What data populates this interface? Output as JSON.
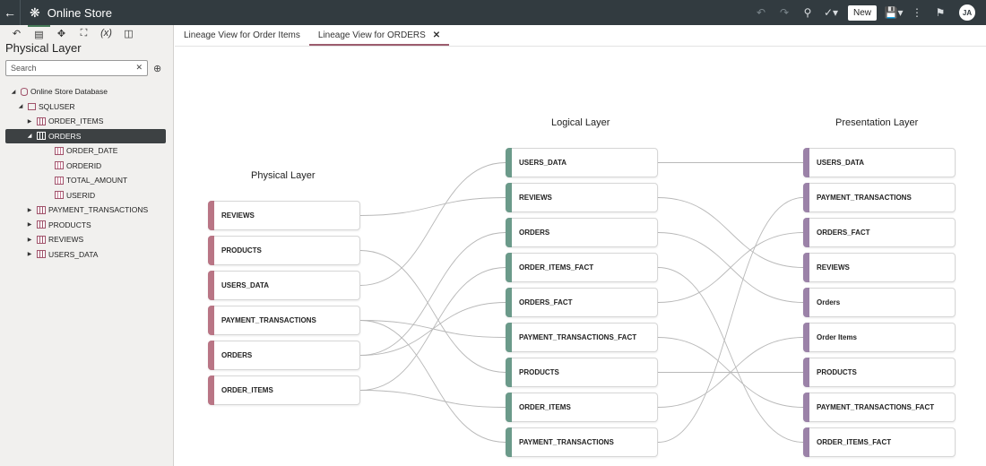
{
  "app": {
    "title": "Online Store",
    "new_label": "New",
    "avatar": "JA"
  },
  "sidebar": {
    "title": "Physical Layer",
    "search_placeholder": "Search",
    "tree": [
      {
        "label": "Online Store Database",
        "kind": "db",
        "twisty": "◢",
        "indent": 0
      },
      {
        "label": "SQLUSER",
        "kind": "schema",
        "twisty": "◢",
        "indent": 1
      },
      {
        "label": "ORDER_ITEMS",
        "kind": "table",
        "twisty": "▶",
        "indent": 2
      },
      {
        "label": "ORDERS",
        "kind": "table",
        "twisty": "◢",
        "indent": 2,
        "selected": true
      },
      {
        "label": "ORDER_DATE",
        "kind": "col",
        "twisty": "",
        "indent": 3
      },
      {
        "label": "ORDERID",
        "kind": "col",
        "twisty": "",
        "indent": 3
      },
      {
        "label": "TOTAL_AMOUNT",
        "kind": "col",
        "twisty": "",
        "indent": 3
      },
      {
        "label": "USERID",
        "kind": "col",
        "twisty": "",
        "indent": 3
      },
      {
        "label": "PAYMENT_TRANSACTIONS",
        "kind": "table",
        "twisty": "▶",
        "indent": 2
      },
      {
        "label": "PRODUCTS",
        "kind": "table",
        "twisty": "▶",
        "indent": 2
      },
      {
        "label": "REVIEWS",
        "kind": "table",
        "twisty": "▶",
        "indent": 2
      },
      {
        "label": "USERS_DATA",
        "kind": "table",
        "twisty": "▶",
        "indent": 2
      }
    ]
  },
  "tabs": [
    {
      "label": "Lineage View for Order Items",
      "active": false
    },
    {
      "label": "Lineage View for ORDERS",
      "active": true
    }
  ],
  "lineage": {
    "physical": {
      "title": "Physical Layer",
      "nodes": [
        "REVIEWS",
        "PRODUCTS",
        "USERS_DATA",
        "PAYMENT_TRANSACTIONS",
        "ORDERS",
        "ORDER_ITEMS"
      ]
    },
    "logical": {
      "title": "Logical Layer",
      "nodes": [
        "USERS_DATA",
        "REVIEWS",
        "ORDERS",
        "ORDER_ITEMS_FACT",
        "ORDERS_FACT",
        "PAYMENT_TRANSACTIONS_FACT",
        "PRODUCTS",
        "ORDER_ITEMS",
        "PAYMENT_TRANSACTIONS"
      ]
    },
    "presentation": {
      "title": "Presentation Layer",
      "nodes": [
        "USERS_DATA",
        "PAYMENT_TRANSACTIONS",
        "ORDERS_FACT",
        "REVIEWS",
        "Orders",
        "Order Items",
        "PRODUCTS",
        "PAYMENT_TRANSACTIONS_FACT",
        "ORDER_ITEMS_FACT"
      ]
    }
  }
}
